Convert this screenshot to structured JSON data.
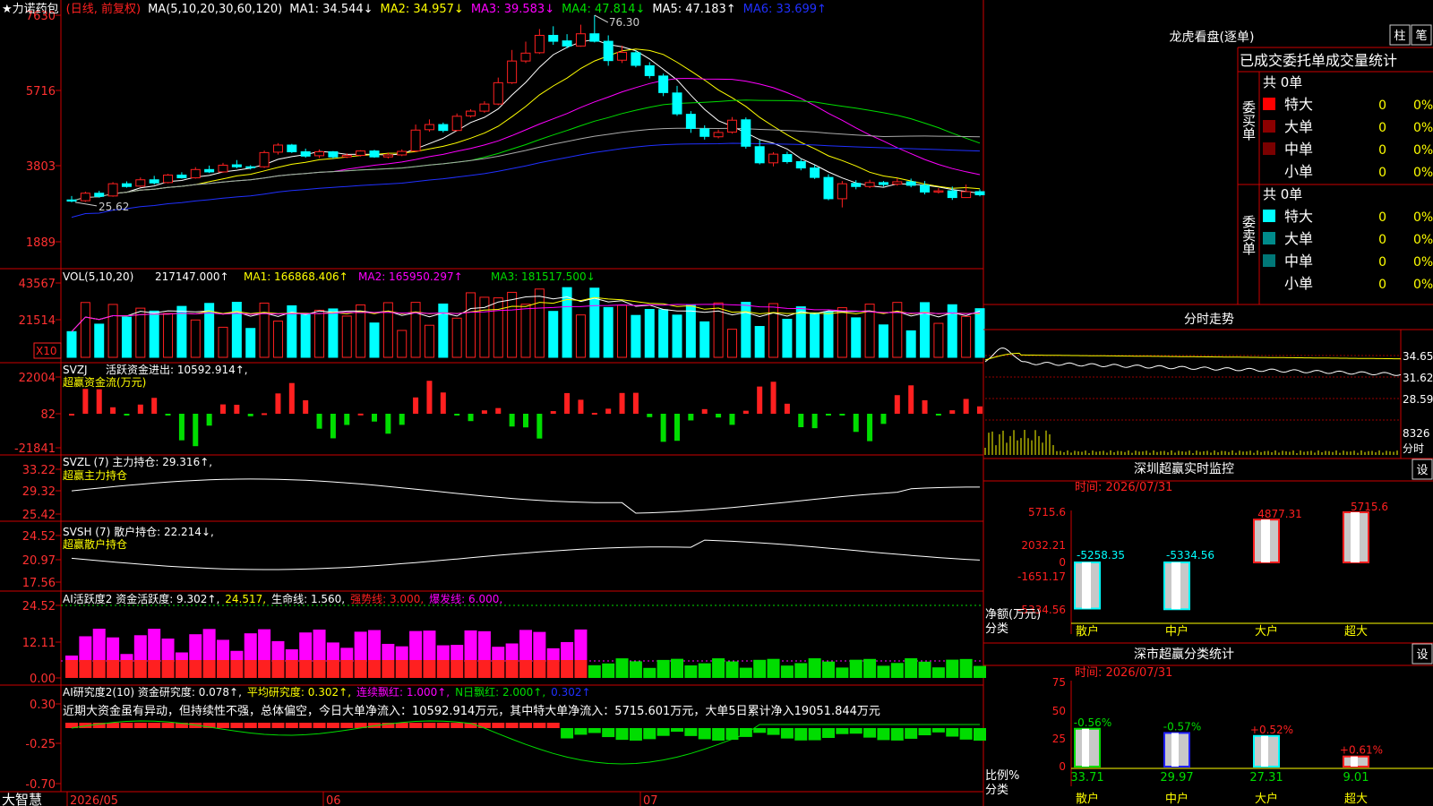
{
  "colors": {
    "up": "#ff2020",
    "down": "#00ffff",
    "grid": "#b00000",
    "axisText": "#ff3030",
    "magenta": "#ff00ff",
    "green": "#00dd00",
    "yellow": "#ffff00",
    "white": "#ffffff",
    "blue": "#2030ff"
  },
  "k_header": {
    "name": "★力诺药包",
    "mode": "(日线, 前复权)",
    "ma_label": "MA(5,10,20,30,60,120)",
    "ma1": "MA1: 34.544↓",
    "ma2": "MA2: 34.957↓",
    "ma3": "MA3: 39.583↓",
    "ma4": "MA4: 47.814↓",
    "ma5": "MA5: 47.183↑",
    "ma6": "MA6: 33.699↑",
    "high_label": "76.30",
    "low_label": "25.62"
  },
  "k_axis": [
    "7630",
    "5716",
    "3803",
    "1889"
  ],
  "vol": {
    "header": "VOL(5,10,20)",
    "value": "217147.000↑",
    "ma1": "MA1: 166868.406↑",
    "ma2": "MA2: 165950.297↑",
    "ma3": "MA3: 181517.500↓",
    "axis": [
      "43567",
      "21514"
    ],
    "unit": "X10"
  },
  "svzj": {
    "header": "SVZJ",
    "title": "活跃资金进出: 10592.914↑,",
    "sub": "超赢资金流(万元)",
    "axis": [
      "22004",
      "82",
      "-21841"
    ]
  },
  "svzl": {
    "header": "SVZL (7) 主力持仓: 29.316↑,",
    "sub": "超赢主力持仓",
    "axis": [
      "33.22",
      "29.32",
      "25.42"
    ]
  },
  "svsh": {
    "header": "SVSH (7) 散户持仓: 22.214↓,",
    "sub": "超赢散户持仓",
    "axis": [
      "24.52",
      "20.97",
      "17.56"
    ]
  },
  "ai_act": {
    "t1": "AI活跃度2 资金活跃度: 9.302↑,",
    "t2": "24.517,",
    "t3": "生命线: 1.560,",
    "t4": "强势线: 3.000,",
    "t5": "爆发线: 6.000,",
    "axis": [
      "24.52",
      "12.11",
      "0.00"
    ]
  },
  "ai_res": {
    "t1": "AI研究度2(10) 资金研究度: 0.078↑,",
    "t2": "平均研究度: 0.302↑,",
    "t3": "连续飘红: 1.000↑,",
    "t4": "N日飘红: 2.000↑,",
    "t5": "0.302↑",
    "comment": "近期大资金虽有异动，但持续性不强，总体偏空，今日大单净流入：10592.914万元，其中特大单净流入：5715.601万元，大单5日累计净入19051.844万元",
    "axis": [
      "0.30",
      "-0.25",
      "-0.70"
    ]
  },
  "dates": [
    "2026/05",
    "06",
    "07"
  ],
  "brand": "大智慧",
  "right": {
    "dragon_title": "龙虎看盘(逐单)",
    "btn_zhu": "柱",
    "btn_bi": "笔",
    "table_title": "已成交委托单成交量统计",
    "buy_label": "委买单",
    "sell_label": "委卖单",
    "buy_total": "共 0单",
    "sell_total": "共 0单",
    "buy_rows": [
      {
        "label": "特大",
        "count": "0",
        "pct": "0%",
        "color": "#ff0000"
      },
      {
        "label": "大单",
        "count": "0",
        "pct": "0%",
        "color": "#8b0000"
      },
      {
        "label": "中单",
        "count": "0",
        "pct": "0%",
        "color": "#7a0000"
      },
      {
        "label": "小单",
        "count": "0",
        "pct": "0%",
        "color": "#000000"
      }
    ],
    "sell_rows": [
      {
        "label": "特大",
        "count": "0",
        "pct": "0%",
        "color": "#00ffff"
      },
      {
        "label": "大单",
        "count": "0",
        "pct": "0%",
        "color": "#008b8b"
      },
      {
        "label": "中单",
        "count": "0",
        "pct": "0%",
        "color": "#007777"
      },
      {
        "label": "小单",
        "count": "0",
        "pct": "0%",
        "color": "#000000"
      }
    ],
    "intraday_title": "分时走势",
    "intraday_axis": [
      "34.65",
      "31.62",
      "28.59"
    ],
    "intraday_vol": "8326",
    "intraday_unit": "分时",
    "monitor_title": "深圳超赢实时监控",
    "btn_set": "设",
    "monitor_time": "时间: 2026/07/31",
    "monitor_axis": [
      "5715.6",
      "2032.21",
      "0",
      "-1651.17",
      "-5334.56"
    ],
    "monitor_unit": "净额(万元)",
    "monitor_cat_label": "分类",
    "monitor_values": [
      {
        "name": "散户",
        "value": -5258.35,
        "label": "-5258.35"
      },
      {
        "name": "中户",
        "value": -5334.56,
        "label": "-5334.56"
      },
      {
        "name": "大户",
        "value": 4877.31,
        "label": "4877.31"
      },
      {
        "name": "超大",
        "value": 5715.6,
        "label": "5715.6"
      }
    ],
    "stat_title": "深市超赢分类统计",
    "stat_time": "时间: 2026/07/31",
    "stat_axis": [
      "75",
      "50",
      "25",
      "0"
    ],
    "stat_unit": "比例%",
    "stat_cat_label": "分类",
    "stat_values": [
      {
        "name": "散户",
        "value": 33.71,
        "label": "33.71",
        "chg": "-0.56%",
        "color": "#00dd00"
      },
      {
        "name": "中户",
        "value": 29.97,
        "label": "29.97",
        "chg": "-0.57%",
        "color": "#2020ff"
      },
      {
        "name": "大户",
        "value": 27.31,
        "label": "27.31",
        "chg": "+0.52%",
        "color": "#00ffff"
      },
      {
        "name": "超大",
        "value": 9.01,
        "label": "9.01",
        "chg": "+0.61%",
        "color": "#ff2020"
      }
    ]
  },
  "chart_data": {
    "type": "candlestick",
    "title": "★力诺药包 (日线, 前复权)",
    "ylim": [
      1889,
      7630
    ],
    "candles": [
      [
        29.5,
        29.2,
        30.5,
        28.9
      ],
      [
        29.3,
        31.2,
        31.6,
        29.0
      ],
      [
        31.2,
        30.4,
        31.8,
        30.1
      ],
      [
        30.5,
        33.6,
        34.0,
        30.3
      ],
      [
        33.6,
        32.9,
        34.2,
        32.6
      ],
      [
        33.0,
        34.6,
        35.2,
        32.8
      ],
      [
        34.6,
        33.8,
        35.6,
        33.4
      ],
      [
        33.9,
        35.8,
        36.1,
        33.7
      ],
      [
        35.8,
        35.1,
        36.5,
        34.9
      ],
      [
        35.1,
        37.2,
        37.8,
        34.9
      ],
      [
        37.2,
        36.6,
        38.2,
        36.3
      ],
      [
        36.6,
        38.3,
        38.9,
        36.4
      ],
      [
        38.4,
        37.9,
        39.6,
        37.5
      ],
      [
        37.9,
        37.8,
        38.3,
        37.2
      ],
      [
        37.9,
        41.5,
        42.0,
        37.6
      ],
      [
        41.6,
        43.4,
        43.9,
        41.0
      ],
      [
        43.4,
        41.7,
        43.7,
        41.4
      ],
      [
        41.7,
        40.6,
        42.5,
        40.2
      ],
      [
        40.7,
        41.7,
        42.3,
        40.1
      ],
      [
        41.7,
        40.4,
        41.9,
        40.0
      ],
      [
        40.4,
        40.8,
        41.3,
        40.1
      ],
      [
        40.8,
        41.9,
        42.1,
        40.5
      ],
      [
        41.9,
        40.4,
        42.2,
        40.2
      ],
      [
        40.4,
        40.9,
        41.5,
        40.0
      ],
      [
        40.9,
        41.8,
        42.3,
        40.6
      ],
      [
        41.9,
        47.2,
        48.6,
        41.6
      ],
      [
        47.3,
        48.6,
        49.9,
        46.8
      ],
      [
        48.6,
        47.1,
        49.1,
        46.6
      ],
      [
        47.1,
        50.7,
        51.4,
        46.9
      ],
      [
        50.8,
        52.0,
        52.5,
        50.4
      ],
      [
        52.0,
        53.8,
        54.5,
        51.6
      ],
      [
        53.8,
        59.2,
        60.5,
        53.5
      ],
      [
        59.2,
        64.7,
        67.5,
        58.9
      ],
      [
        64.7,
        66.7,
        69.6,
        64.2
      ],
      [
        66.8,
        71.2,
        72.8,
        66.5
      ],
      [
        71.2,
        69.7,
        73.5,
        68.8
      ],
      [
        69.8,
        68.5,
        71.5,
        67.9
      ],
      [
        68.5,
        71.6,
        73.9,
        68.3
      ],
      [
        71.6,
        69.7,
        76.3,
        69.4
      ],
      [
        69.7,
        64.8,
        71.2,
        63.5
      ],
      [
        64.9,
        66.9,
        68.6,
        64.2
      ],
      [
        66.8,
        63.6,
        67.4,
        63.1
      ],
      [
        63.5,
        61.0,
        64.4,
        60.3
      ],
      [
        60.9,
        56.7,
        61.5,
        55.8
      ],
      [
        56.6,
        51.3,
        58.4,
        50.8
      ],
      [
        51.2,
        47.6,
        52.0,
        46.5
      ],
      [
        47.5,
        45.6,
        48.4,
        44.8
      ],
      [
        45.5,
        46.6,
        47.3,
        45.1
      ],
      [
        46.7,
        49.7,
        50.5,
        46.3
      ],
      [
        49.8,
        43.1,
        50.4,
        42.5
      ],
      [
        43.0,
        38.9,
        44.7,
        38.5
      ],
      [
        38.9,
        41.1,
        41.6,
        38.0
      ],
      [
        41.0,
        39.2,
        41.7,
        38.7
      ],
      [
        39.2,
        37.6,
        39.8,
        37.0
      ],
      [
        37.6,
        35.2,
        38.3,
        34.8
      ],
      [
        35.2,
        29.8,
        36.0,
        29.4
      ],
      [
        29.8,
        33.6,
        34.3,
        27.6
      ],
      [
        33.7,
        32.9,
        34.5,
        32.2
      ],
      [
        32.9,
        33.9,
        34.6,
        32.5
      ],
      [
        33.9,
        33.4,
        34.3,
        32.9
      ],
      [
        33.5,
        34.1,
        35.0,
        33.1
      ],
      [
        34.1,
        33.2,
        34.9,
        32.7
      ],
      [
        33.2,
        31.5,
        34.3,
        30.9
      ],
      [
        31.5,
        31.8,
        32.5,
        31.1
      ],
      [
        31.8,
        30.1,
        32.9,
        29.5
      ],
      [
        30.1,
        31.6,
        33.4,
        30.0
      ],
      [
        31.6,
        30.8,
        32.2,
        30.4
      ]
    ]
  }
}
